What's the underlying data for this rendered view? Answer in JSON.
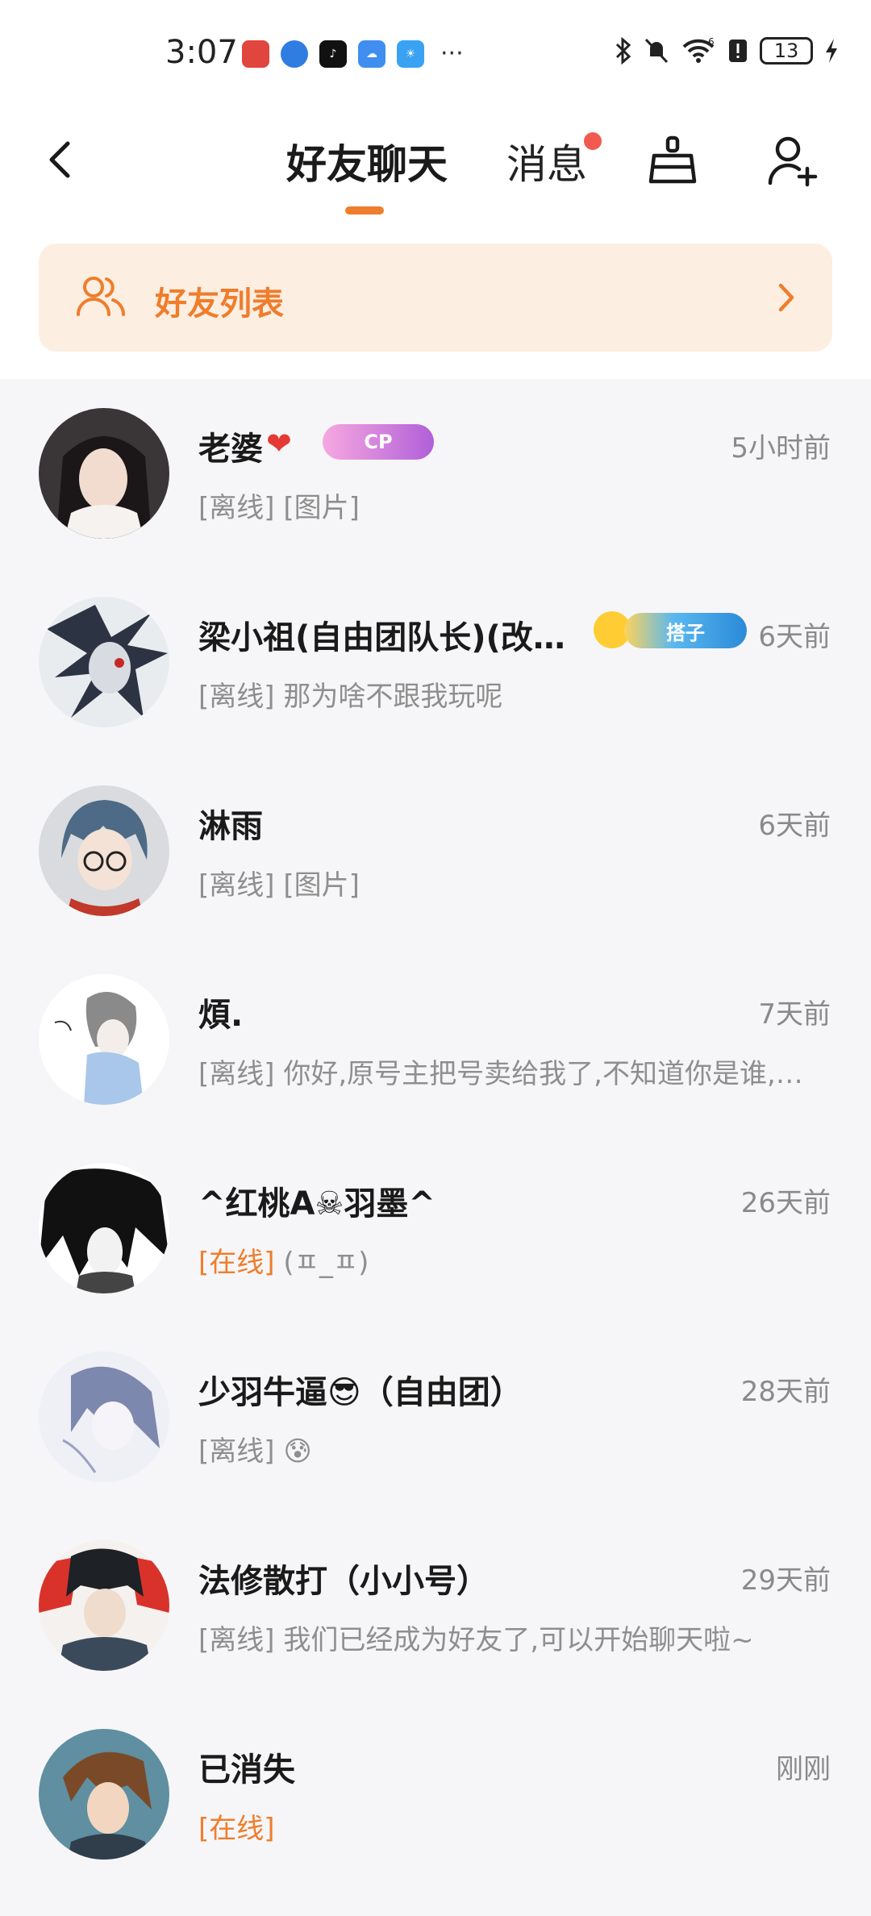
{
  "status_bar": {
    "time": "3:07",
    "battery": "13",
    "signal_label": "6"
  },
  "header": {
    "tab_friends": "好友聊天",
    "tab_messages": "消息"
  },
  "banner": {
    "label": "好友列表"
  },
  "chats": [
    {
      "name": "老婆",
      "time": "5小时前",
      "status": "[离线]",
      "online": false,
      "preview": " [图片]",
      "badge": "CP"
    },
    {
      "name": "梁小祖(自由团队长)(改…",
      "time": "6天前",
      "status": "[离线]",
      "online": false,
      "preview": " 那为啥不跟我玩呢",
      "badge": "搭子"
    },
    {
      "name": "淋雨",
      "time": "6天前",
      "status": "[离线]",
      "online": false,
      "preview": " [图片]"
    },
    {
      "name": "煩.",
      "time": "7天前",
      "status": "[离线]",
      "online": false,
      "preview": " 你好,原号主把号卖给我了,不知道你是谁,…"
    },
    {
      "name": "^红桃A☠羽墨^",
      "time": "26天前",
      "status": "[在线]",
      "online": true,
      "preview": " (ㅍ_ㅍ)"
    },
    {
      "name": "少羽牛逼😎（自由团）",
      "time": "28天前",
      "status": "[离线]",
      "online": false,
      "preview": " 😰"
    },
    {
      "name": "法修散打（小小号）",
      "time": "29天前",
      "status": "[离线]",
      "online": false,
      "preview": " 我们已经成为好友了,可以开始聊天啦~"
    },
    {
      "name": "已消失",
      "time": "刚刚",
      "status": "[在线]",
      "online": true,
      "preview": ""
    }
  ],
  "colors": {
    "accent": "#ef7d2b",
    "banner_bg": "#fdeee2",
    "unread_dot": "#f25a4f",
    "list_bg": "#f6f6f8"
  }
}
